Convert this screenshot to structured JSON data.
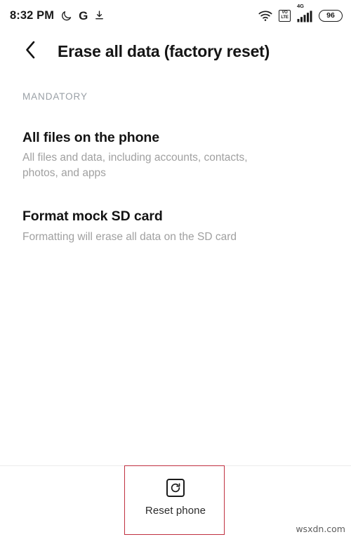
{
  "statusbar": {
    "time": "8:32 PM",
    "left_icons": [
      {
        "name": "dnd-moon-icon",
        "glyph": "☾"
      },
      {
        "name": "google-g-icon",
        "glyph": "G"
      },
      {
        "name": "download-icon",
        "glyph": "⬇"
      }
    ],
    "wifi_icon": "wifi-icon",
    "volte": {
      "line1": "VO",
      "line2": "LTE"
    },
    "network_type": "4G",
    "signal_icon": "signal-bars-icon",
    "battery_level": "96"
  },
  "header": {
    "back_icon": "back-chevron-icon",
    "title": "Erase all data (factory reset)"
  },
  "content": {
    "section_label": "MANDATORY",
    "items": [
      {
        "title": "All files on the phone",
        "desc": "All files and data, including accounts, contacts, photos, and apps"
      },
      {
        "title": "Format mock SD card",
        "desc": "Formatting will erase all data on the SD card"
      }
    ]
  },
  "bottom": {
    "reset_icon": "reset-phone-icon",
    "reset_label": "Reset phone"
  },
  "annotation": {
    "highlight_color": "#c03040"
  },
  "watermark": "wsxdn.com"
}
